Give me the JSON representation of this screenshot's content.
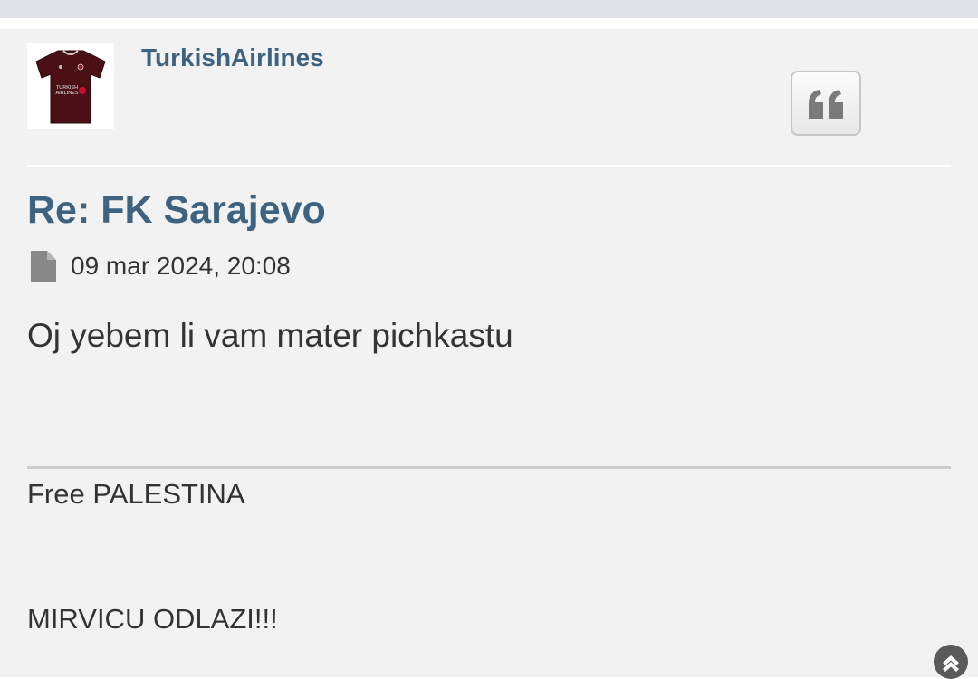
{
  "post": {
    "username": "TurkishAirlines",
    "title": "Re: FK Sarajevo",
    "date": "09 mar 2024, 20:08",
    "body": "Oj yebem li vam mater pichkastu",
    "signature": {
      "line1": "Free PALESTINA",
      "line2": "MIRVICU ODLAZI!!!"
    },
    "avatar": {
      "icon": "jersey-avatar-icon",
      "shirt_text_1": "TURKISH",
      "shirt_text_2": "AIRLINES"
    }
  },
  "icons": {
    "quote": "quote-icon",
    "post": "file-icon",
    "scroll_top": "chevron-up-circle-icon"
  },
  "colors": {
    "accent": "#3d6381",
    "text": "#333333",
    "background": "#f2f2f2",
    "top_band": "#dfe3e7"
  }
}
